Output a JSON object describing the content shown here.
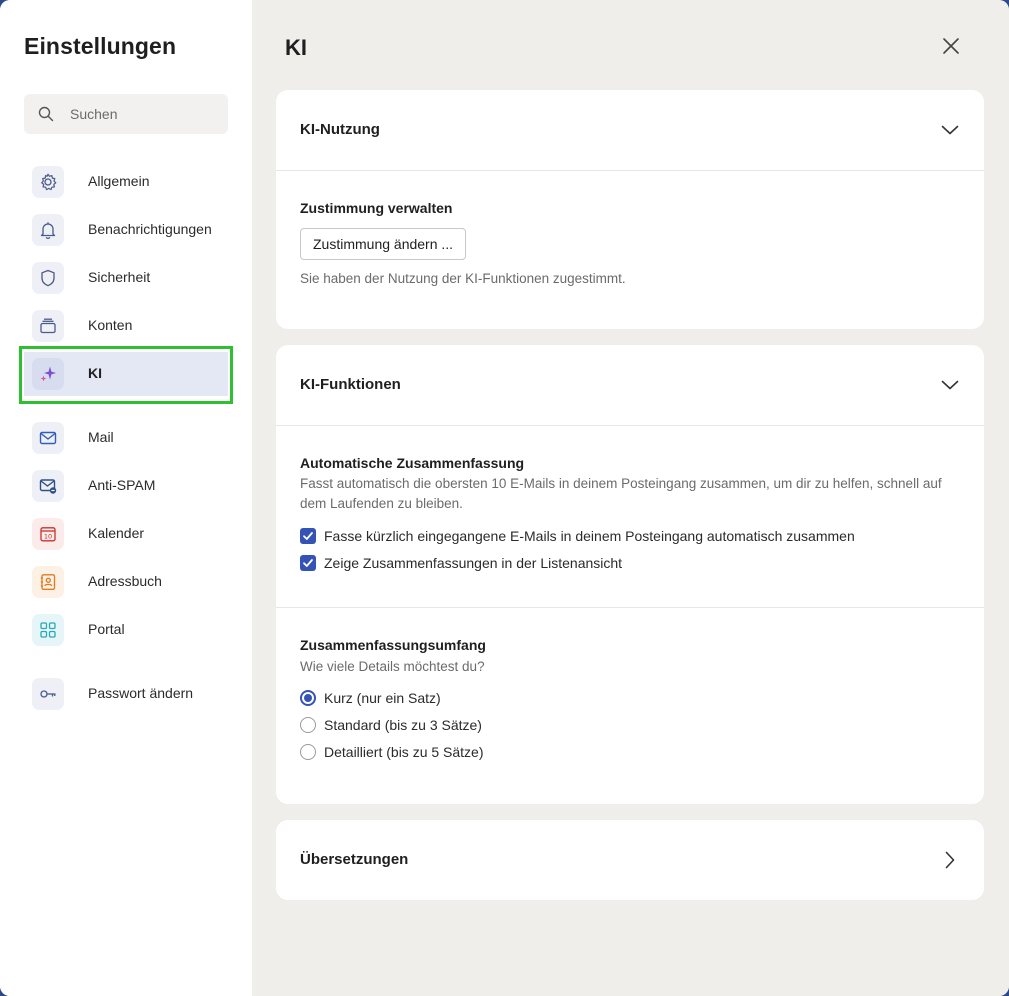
{
  "sidebar": {
    "title": "Einstellungen",
    "search_placeholder": "Suchen",
    "items": [
      {
        "label": "Allgemein",
        "icon": "gear-icon"
      },
      {
        "label": "Benachrichtigungen",
        "icon": "bell-icon"
      },
      {
        "label": "Sicherheit",
        "icon": "shield-icon"
      },
      {
        "label": "Konten",
        "icon": "accounts-icon"
      },
      {
        "label": "KI",
        "icon": "sparkle-icon",
        "active": true
      },
      {
        "label": "Mail",
        "icon": "mail-icon"
      },
      {
        "label": "Anti-SPAM",
        "icon": "spam-mail-icon"
      },
      {
        "label": "Kalender",
        "icon": "calendar-icon",
        "badge": "10"
      },
      {
        "label": "Adressbuch",
        "icon": "address-book-icon"
      },
      {
        "label": "Portal",
        "icon": "grid-icon"
      },
      {
        "label": "Passwort ändern",
        "icon": "key-icon"
      }
    ]
  },
  "main": {
    "title": "KI",
    "cards": {
      "usage": {
        "header": "KI-Nutzung",
        "consent_title": "Zustimmung verwalten",
        "consent_button": "Zustimmung ändern ...",
        "consent_status": "Sie haben der Nutzung der KI-Funktionen zugestimmt."
      },
      "features": {
        "header": "KI-Funktionen",
        "auto_summary_title": "Automatische Zusammenfassung",
        "auto_summary_desc": "Fasst automatisch die obersten 10 E-Mails in deinem Posteingang zusammen, um dir zu helfen, schnell auf dem Laufenden zu bleiben.",
        "checkboxes": [
          {
            "label": "Fasse kürzlich eingegangene E-Mails in deinem Posteingang automatisch zusammen",
            "checked": true
          },
          {
            "label": "Zeige Zusammenfassungen in der Listenansicht",
            "checked": true
          }
        ],
        "scope_title": "Zusammenfassungsumfang",
        "scope_question": "Wie viele Details möchtest du?",
        "radios": [
          {
            "label": "Kurz (nur ein Satz)",
            "selected": true
          },
          {
            "label": "Standard (bis zu 3 Sätze)",
            "selected": false
          },
          {
            "label": "Detailliert (bis zu 5 Sätze)",
            "selected": false
          }
        ]
      },
      "translations": {
        "header": "Übersetzungen"
      }
    }
  },
  "colors": {
    "accent": "#3553b4",
    "highlight": "#2fc02f",
    "sidebar_active": "#e4e7f4",
    "main_bg": "#efeeeb"
  }
}
